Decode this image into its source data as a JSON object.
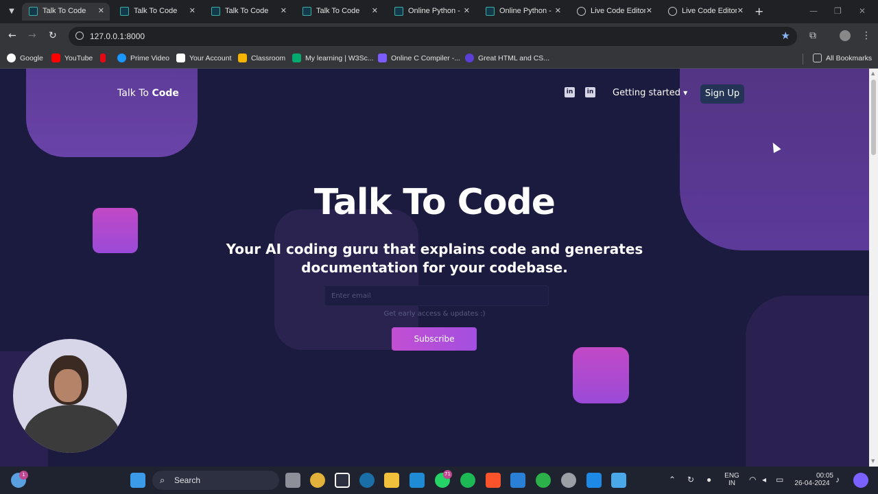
{
  "browser": {
    "tabs": [
      {
        "label": "Talk To Code",
        "active": true,
        "icon": "app-favicon"
      },
      {
        "label": "Talk To Code",
        "active": false,
        "icon": "app-favicon"
      },
      {
        "label": "Talk To Code",
        "active": false,
        "icon": "app-favicon"
      },
      {
        "label": "Talk To Code",
        "active": false,
        "icon": "app-favicon"
      },
      {
        "label": "Online Python -",
        "active": false,
        "icon": "app-favicon"
      },
      {
        "label": "Online Python -",
        "active": false,
        "icon": "app-favicon"
      },
      {
        "label": "Live Code Editor",
        "active": false,
        "icon": "globe-icon"
      },
      {
        "label": "Live Code Editor",
        "active": false,
        "icon": "globe-icon"
      }
    ],
    "url": "127.0.0.1:8000",
    "bookmarks": [
      {
        "label": "Google",
        "color": "#ea4335"
      },
      {
        "label": "YouTube",
        "color": "#ff0000"
      },
      {
        "label": "",
        "color": "#e50914"
      },
      {
        "label": "Prime Video",
        "color": "#1a98ff"
      },
      {
        "label": "Your Account",
        "color": "#ffffff"
      },
      {
        "label": "Classroom",
        "color": "#f4b400"
      },
      {
        "label": "My learning | W3Sc...",
        "color": "#04aa6d"
      },
      {
        "label": "Online C Compiler -...",
        "color": "#7c5cff"
      },
      {
        "label": "Great HTML and CS...",
        "color": "#5b3fd6"
      }
    ],
    "all_bookmarks": "All Bookmarks"
  },
  "site": {
    "logo_regular": "Talk To ",
    "logo_bold": "Code",
    "nav_getting_started": "Getting started",
    "nav_signup": "Sign Up",
    "hero_title": "Talk To Code",
    "hero_subtitle": "Your AI coding guru that explains code and generates documentation for your codebase.",
    "email_placeholder": "Enter email",
    "early_access_note": "Get early access & updates :)",
    "subscribe_label": "Subscribe"
  },
  "taskbar": {
    "search_label": "Search",
    "whatsapp_badge": "71",
    "weather_badge": "1",
    "lang_top": "ENG",
    "lang_bottom": "IN",
    "time": "00:05",
    "date": "26-04-2024"
  },
  "colors": {
    "page_bg": "#1b1a3f",
    "accent": "#c24fd2",
    "signup_bg": "#243456"
  }
}
